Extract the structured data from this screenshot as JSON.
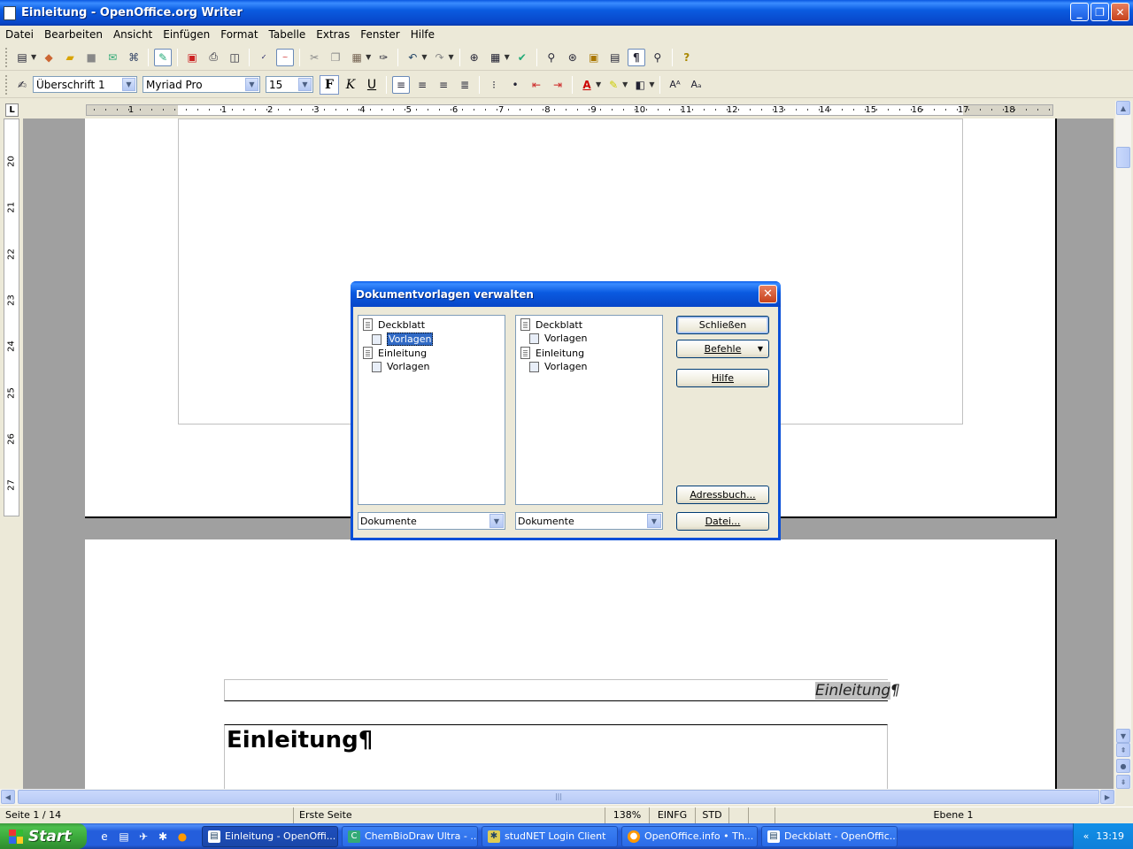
{
  "window": {
    "title": "Einleitung - OpenOffice.org Writer",
    "buttons": [
      "_",
      "❐",
      "✕"
    ]
  },
  "menu": [
    "Datei",
    "Bearbeiten",
    "Ansicht",
    "Einfügen",
    "Format",
    "Tabelle",
    "Extras",
    "Fenster",
    "Hilfe"
  ],
  "formatting": {
    "paragraph_style": "Überschrift 1",
    "font_name": "Myriad Pro",
    "font_size": "15",
    "bold": "F",
    "italic": "K",
    "underline": "U"
  },
  "ruler": {
    "h_ticks": [
      "1",
      "1",
      "2",
      "3",
      "4",
      "5",
      "6",
      "7",
      "8",
      "9",
      "10",
      "11",
      "12",
      "13",
      "14",
      "15",
      "16",
      "17",
      "18"
    ],
    "v_ticks": [
      "20",
      "21",
      "22",
      "23",
      "24",
      "25",
      "26",
      "27"
    ]
  },
  "document": {
    "header_text": "Einleitung",
    "header_mark": "¶",
    "heading_text": "Einleitung¶"
  },
  "dialog": {
    "title": "Dokumentvorlagen verwalten",
    "left_tree": [
      {
        "label": "Deckblatt",
        "children": [
          "Vorlagen"
        ]
      },
      {
        "label": "Einleitung",
        "children": [
          "Vorlagen"
        ]
      }
    ],
    "right_tree": [
      {
        "label": "Deckblatt",
        "children": [
          "Vorlagen"
        ]
      },
      {
        "label": "Einleitung",
        "children": [
          "Vorlagen"
        ]
      }
    ],
    "left_combo": "Dokumente",
    "right_combo": "Dokumente",
    "buttons": {
      "close": "Schließen",
      "commands": "Befehle",
      "help": "Hilfe",
      "addressbook": "Adressbuch...",
      "file": "Datei..."
    }
  },
  "status": {
    "page": "Seite 1 / 14",
    "page_style": "Erste Seite",
    "zoom": "138%",
    "insert_mode": "EINFG",
    "selection_mode": "STD",
    "level": "Ebene 1"
  },
  "taskbar": {
    "start": "Start",
    "tasks": [
      "Einleitung - OpenOffi...",
      "ChemBioDraw Ultra - ...",
      "studNET Login Client",
      "OpenOffice.info • Th...",
      "Deckblatt - OpenOffic..."
    ],
    "active_task": 0,
    "clock": "13:19"
  }
}
